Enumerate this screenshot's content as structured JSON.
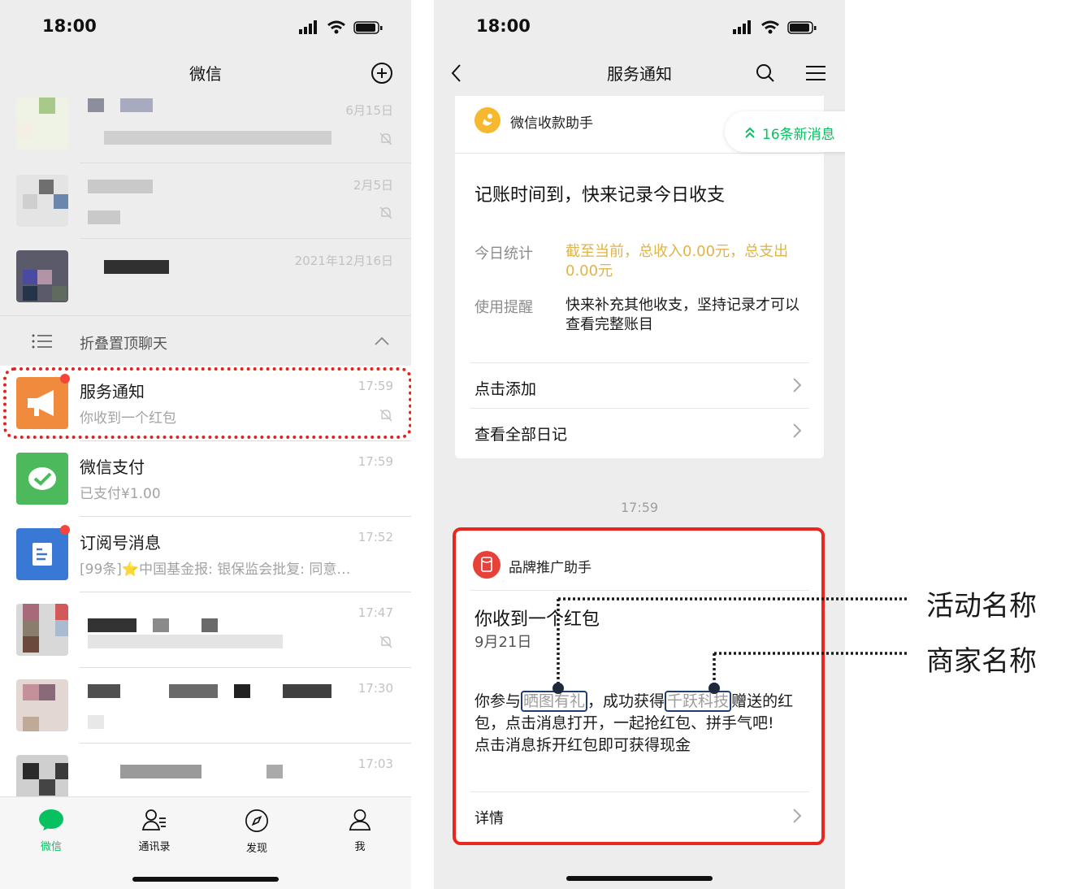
{
  "left_phone": {
    "status_time": "18:00",
    "title": "微信",
    "blurred_rows": [
      {
        "time": "6月15日"
      },
      {
        "time": "2月5日"
      },
      {
        "time": "2021年12月16日"
      }
    ],
    "folded_label": "折叠置顶聊天",
    "chats": [
      {
        "name": "服务通知",
        "preview": "你收到一个红包",
        "time": "17:59",
        "avatar_color": "#f08a3c"
      },
      {
        "name": "微信支付",
        "preview": "已支付¥1.00",
        "time": "17:59",
        "avatar_color": "#4cba5c"
      },
      {
        "name": "订阅号消息",
        "preview": "[99条]⭐中国基金报: 银保监会批复: 同意…",
        "time": "17:52",
        "avatar_color": "#3a78d6"
      }
    ],
    "blurred_rows_bottom": [
      {
        "time": "17:47"
      },
      {
        "time": "17:30"
      },
      {
        "time": "17:03"
      }
    ],
    "tabs": [
      {
        "label": "微信",
        "icon": "chat-bubble-icon",
        "active": true
      },
      {
        "label": "通讯录",
        "icon": "contacts-icon"
      },
      {
        "label": "发现",
        "icon": "compass-icon"
      },
      {
        "label": "我",
        "icon": "person-icon"
      }
    ],
    "accent_color": "#07c160"
  },
  "right_phone": {
    "status_time": "18:00",
    "title": "服务通知",
    "new_messages_badge": "16条新消息",
    "card1": {
      "source": "微信收款助手",
      "title": "记账时间到，快来记录今日收支",
      "stats_key": "今日统计",
      "stats_value": "截至当前，总收入0.00元，总支出0.00元",
      "reminder_key": "使用提醒",
      "reminder_value": "快来补充其他收支，坚持记录才可以查看完整账目",
      "link1": "点击添加",
      "link2": "查看全部日记"
    },
    "timestamp": "17:59",
    "card2": {
      "source": "品牌推广助手",
      "title": "你收到一个红包",
      "date": "9月21日",
      "body_part1": "你参与",
      "activity_name": "晒图有礼",
      "body_part2": "，成功获得",
      "merchant_name": "千跃科技",
      "body_part3": "赠送的红包，点击消息打开，一起抢红包、拼手气吧!",
      "body_line2": "点击消息拆开红包即可获得现金",
      "details": "详情"
    }
  },
  "annotations": {
    "activity_label": "活动名称",
    "merchant_label": "商家名称"
  }
}
